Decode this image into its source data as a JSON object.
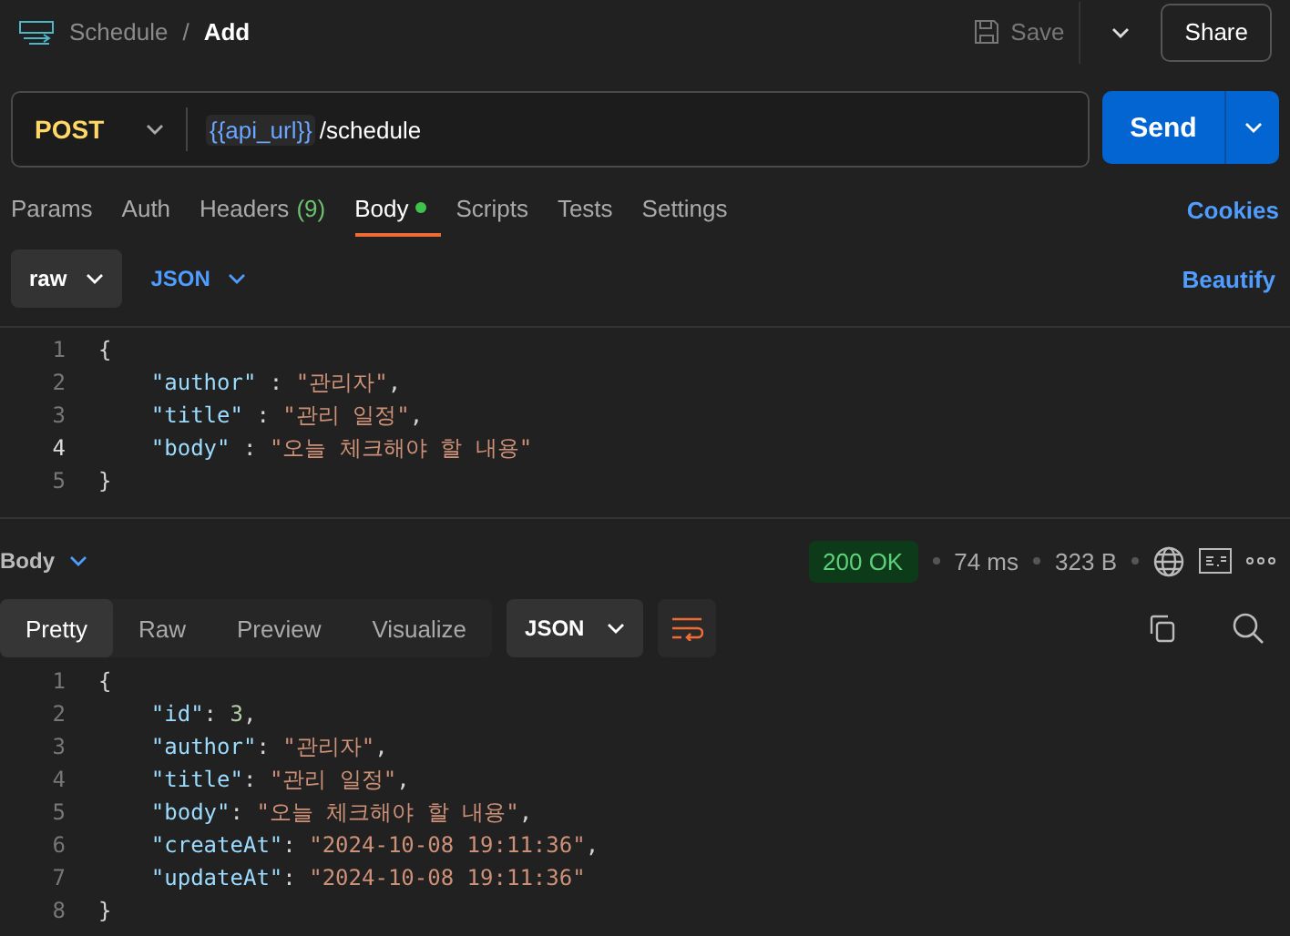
{
  "header": {
    "breadcrumb": [
      "Schedule",
      "Add"
    ],
    "separator": "/",
    "save": "Save",
    "share": "Share"
  },
  "request": {
    "method": "POST",
    "url_variable": "{{api_url}}",
    "url_path": "/schedule",
    "send": "Send"
  },
  "tabs": [
    {
      "label": "Params",
      "selected": false,
      "dot": false
    },
    {
      "label": "Auth",
      "selected": false,
      "dot": false
    },
    {
      "label": "Headers",
      "count": "(9)",
      "selected": false,
      "dot": false
    },
    {
      "label": "Body",
      "selected": true,
      "dot": true
    },
    {
      "label": "Scripts",
      "selected": false,
      "dot": false
    },
    {
      "label": "Tests",
      "selected": false,
      "dot": false
    },
    {
      "label": "Settings",
      "selected": false,
      "dot": false
    }
  ],
  "cookies": "Cookies",
  "body_options": {
    "mode": "raw",
    "language": "JSON",
    "beautify": "Beautify"
  },
  "request_body": [
    {
      "number": "1",
      "current": false,
      "tokens": [
        {
          "kind": "punct",
          "text": "{"
        }
      ]
    },
    {
      "number": "2",
      "current": false,
      "tokens": [
        {
          "kind": "key",
          "text": "    \"author\""
        },
        {
          "kind": "punct",
          "text": " : "
        },
        {
          "kind": "string",
          "text": "\"관리자\""
        },
        {
          "kind": "punct",
          "text": ","
        }
      ]
    },
    {
      "number": "3",
      "current": false,
      "tokens": [
        {
          "kind": "key",
          "text": "    \"title\""
        },
        {
          "kind": "punct",
          "text": " : "
        },
        {
          "kind": "string",
          "text": "\"관리 일정\""
        },
        {
          "kind": "punct",
          "text": ","
        }
      ]
    },
    {
      "number": "4",
      "current": true,
      "tokens": [
        {
          "kind": "key",
          "text": "    \"body\""
        },
        {
          "kind": "punct",
          "text": " : "
        },
        {
          "kind": "string",
          "text": "\"오늘 체크해야 할 내용\""
        }
      ]
    },
    {
      "number": "5",
      "current": false,
      "tokens": [
        {
          "kind": "punct",
          "text": "}"
        }
      ]
    }
  ],
  "response": {
    "label": "Body",
    "status": "200 OK",
    "time": "74 ms",
    "size": "323 B",
    "views": [
      {
        "label": "Pretty",
        "selected": true
      },
      {
        "label": "Raw",
        "selected": false
      },
      {
        "label": "Preview",
        "selected": false
      },
      {
        "label": "Visualize",
        "selected": false
      }
    ],
    "format": "JSON",
    "lines": [
      {
        "number": "1",
        "tokens": [
          {
            "kind": "punct",
            "text": "{"
          }
        ]
      },
      {
        "number": "2",
        "tokens": [
          {
            "kind": "key",
            "text": "    \"id\""
          },
          {
            "kind": "punct",
            "text": ": "
          },
          {
            "kind": "number",
            "text": "3"
          },
          {
            "kind": "punct",
            "text": ","
          }
        ]
      },
      {
        "number": "3",
        "tokens": [
          {
            "kind": "key",
            "text": "    \"author\""
          },
          {
            "kind": "punct",
            "text": ": "
          },
          {
            "kind": "string",
            "text": "\"관리자\""
          },
          {
            "kind": "punct",
            "text": ","
          }
        ]
      },
      {
        "number": "4",
        "tokens": [
          {
            "kind": "key",
            "text": "    \"title\""
          },
          {
            "kind": "punct",
            "text": ": "
          },
          {
            "kind": "string",
            "text": "\"관리 일정\""
          },
          {
            "kind": "punct",
            "text": ","
          }
        ]
      },
      {
        "number": "5",
        "tokens": [
          {
            "kind": "key",
            "text": "    \"body\""
          },
          {
            "kind": "punct",
            "text": ": "
          },
          {
            "kind": "string",
            "text": "\"오늘 체크해야 할 내용\""
          },
          {
            "kind": "punct",
            "text": ","
          }
        ]
      },
      {
        "number": "6",
        "tokens": [
          {
            "kind": "key",
            "text": "    \"createAt\""
          },
          {
            "kind": "punct",
            "text": ": "
          },
          {
            "kind": "string",
            "text": "\"2024-10-08 19:11:36\""
          },
          {
            "kind": "punct",
            "text": ","
          }
        ]
      },
      {
        "number": "7",
        "tokens": [
          {
            "kind": "key",
            "text": "    \"updateAt\""
          },
          {
            "kind": "punct",
            "text": ": "
          },
          {
            "kind": "string",
            "text": "\"2024-10-08 19:11:36\""
          }
        ]
      },
      {
        "number": "8",
        "tokens": [
          {
            "kind": "punct",
            "text": "}"
          }
        ]
      }
    ]
  }
}
